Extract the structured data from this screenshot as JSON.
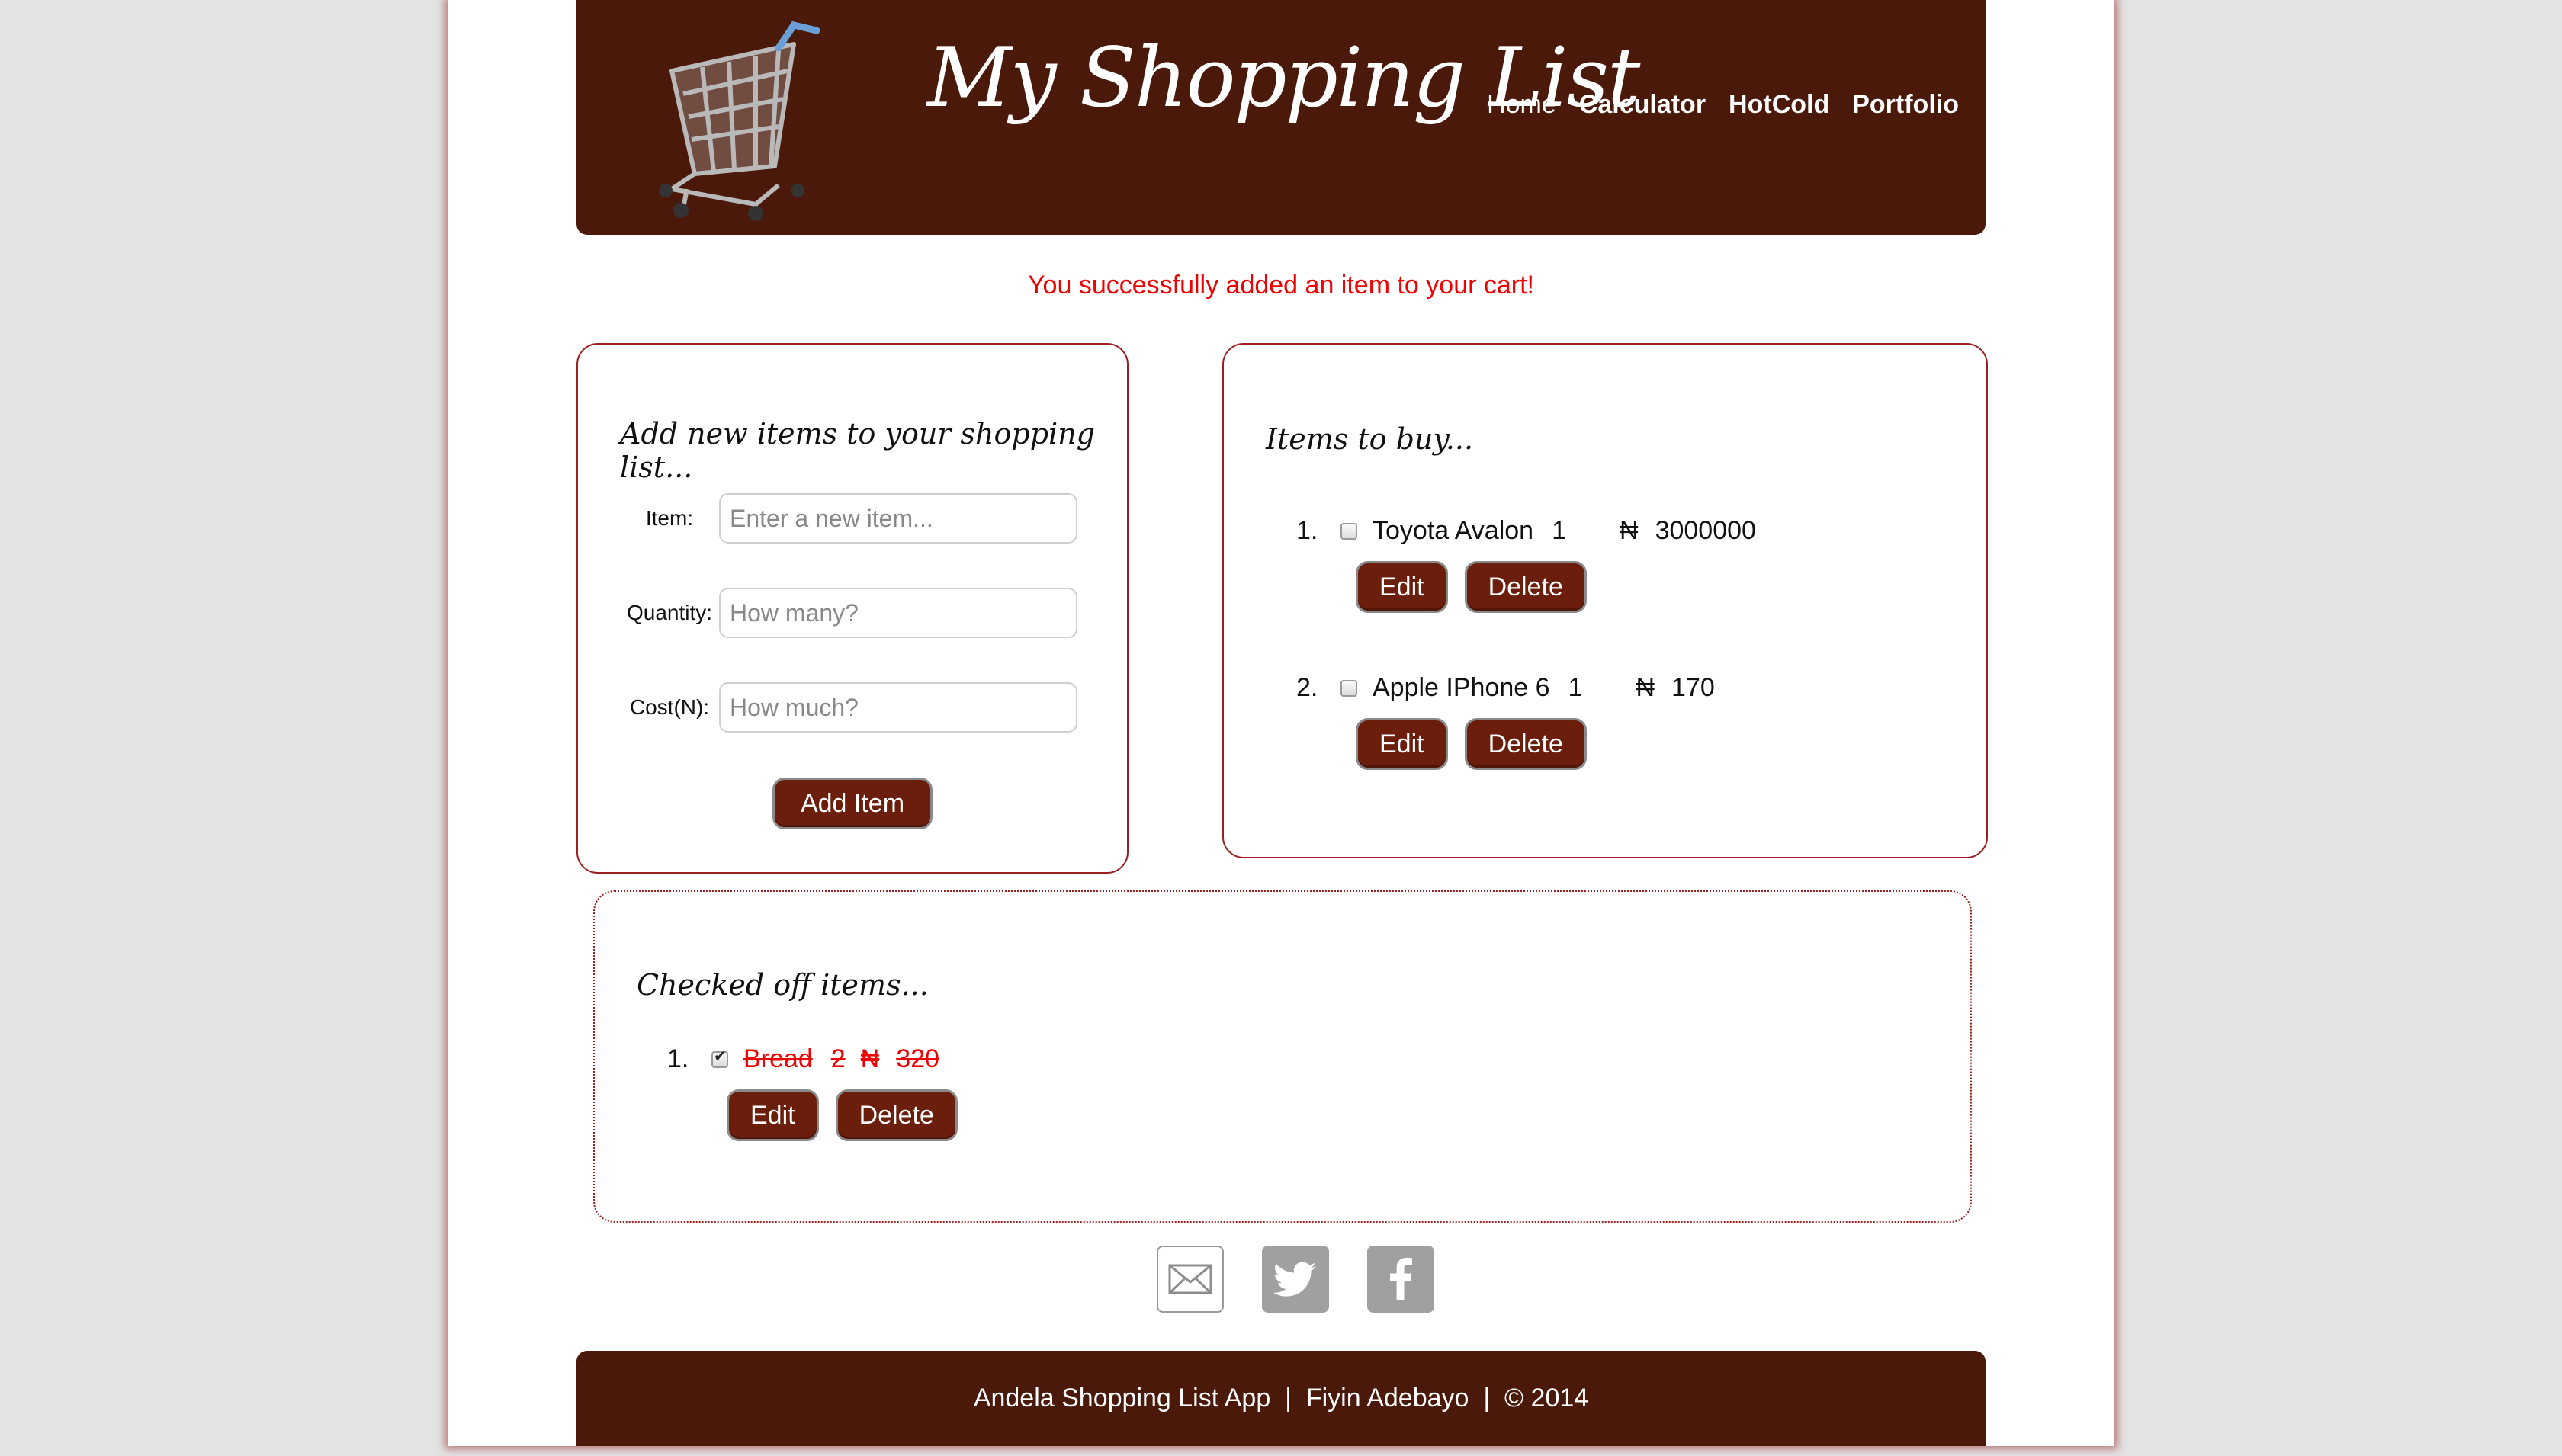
{
  "header": {
    "title": "My Shopping List",
    "nav": [
      {
        "label": "Home"
      },
      {
        "label": "Calculator"
      },
      {
        "label": "HotCold"
      },
      {
        "label": "Portfolio"
      }
    ]
  },
  "flash_message": "You successfully added an item to your cart!",
  "add_form": {
    "title": "Add new items to your shopping list...",
    "item_label": "Item:",
    "item_placeholder": "Enter a new item...",
    "quantity_label": "Quantity:",
    "quantity_placeholder": "How many?",
    "cost_label": "Cost(N):",
    "cost_placeholder": "How much?",
    "submit_label": "Add Item"
  },
  "to_buy": {
    "title": "Items to buy...",
    "items": [
      {
        "num": "1.",
        "name": "Toyota Avalon",
        "qty": "1",
        "currency": "₦",
        "cost": "3000000",
        "checked": false,
        "edit_label": "Edit",
        "delete_label": "Delete"
      },
      {
        "num": "2.",
        "name": "Apple IPhone 6",
        "qty": "1",
        "currency": "₦",
        "cost": "170",
        "checked": false,
        "edit_label": "Edit",
        "delete_label": "Delete"
      }
    ]
  },
  "checked_off": {
    "title": "Checked off items...",
    "items": [
      {
        "num": "1.",
        "name": "Bread",
        "qty": "2",
        "currency": "₦",
        "cost": "320",
        "checked": true,
        "edit_label": "Edit",
        "delete_label": "Delete"
      }
    ]
  },
  "social": [
    "mail-icon",
    "twitter-icon",
    "facebook-icon"
  ],
  "footer": {
    "text": "Andela Shopping List App  |  Fiyin Adebayo  |  © 2014"
  },
  "colors": {
    "brand": "#4a190a",
    "button": "#6b1e0c",
    "panel_border": "#9c2020",
    "alert": "#f00000"
  }
}
